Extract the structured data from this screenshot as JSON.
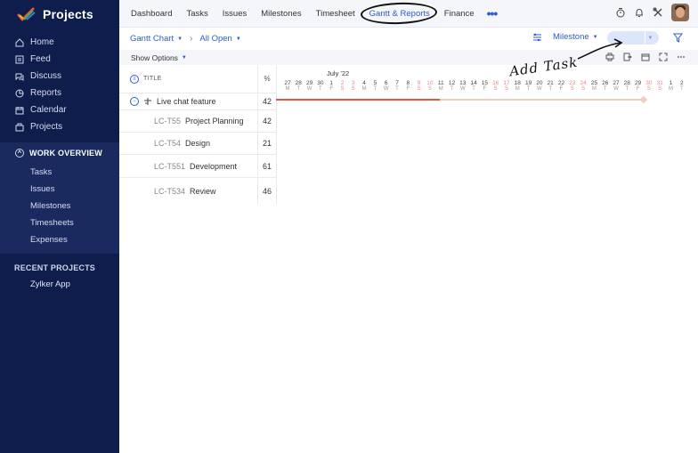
{
  "sidebar": {
    "brand": "Projects",
    "nav": [
      {
        "label": "Home",
        "icon": "home-icon"
      },
      {
        "label": "Feed",
        "icon": "feed-icon"
      },
      {
        "label": "Discuss",
        "icon": "discuss-icon"
      },
      {
        "label": "Reports",
        "icon": "reports-icon"
      },
      {
        "label": "Calendar",
        "icon": "calendar-icon"
      },
      {
        "label": "Projects",
        "icon": "projects-icon"
      }
    ],
    "work_overview": {
      "heading": "WORK OVERVIEW",
      "items": [
        "Tasks",
        "Issues",
        "Milestones",
        "Timesheets",
        "Expenses"
      ]
    },
    "recent": {
      "heading": "RECENT PROJECTS",
      "items": [
        "Zylker App"
      ]
    },
    "colors": {
      "background": "#0f1d4d",
      "section": "#1b2a5e"
    }
  },
  "topnav": {
    "tabs": [
      "Dashboard",
      "Tasks",
      "Issues",
      "Milestones",
      "Timesheet",
      "Gantt & Reports",
      "Finance"
    ],
    "active": "Gantt & Reports",
    "more": "•••"
  },
  "toolbar": {
    "view": "Gantt Chart",
    "filter": "All Open",
    "group_by": "Milestone"
  },
  "options": {
    "show_options": "Show Options"
  },
  "table": {
    "title_header": "TITLE",
    "pct_header": "%",
    "parent": {
      "title": "Live chat feature",
      "pct": "42"
    },
    "tasks": [
      {
        "id": "LC-T55",
        "name": "Project Planning",
        "pct": "42"
      },
      {
        "id": "LC-T54",
        "name": "Design",
        "pct": "21"
      },
      {
        "id": "LC-T551",
        "name": "Development",
        "pct": "61"
      },
      {
        "id": "LC-T534",
        "name": "Review",
        "pct": "46"
      }
    ]
  },
  "timeline": {
    "month": "July '22",
    "days": [
      {
        "n": "27",
        "d": "M"
      },
      {
        "n": "28",
        "d": "T"
      },
      {
        "n": "29",
        "d": "W"
      },
      {
        "n": "30",
        "d": "T"
      },
      {
        "n": "1",
        "d": "F"
      },
      {
        "n": "2",
        "d": "S"
      },
      {
        "n": "3",
        "d": "S"
      },
      {
        "n": "4",
        "d": "M"
      },
      {
        "n": "5",
        "d": "T"
      },
      {
        "n": "6",
        "d": "W"
      },
      {
        "n": "7",
        "d": "T"
      },
      {
        "n": "8",
        "d": "F"
      },
      {
        "n": "9",
        "d": "S"
      },
      {
        "n": "10",
        "d": "S"
      },
      {
        "n": "11",
        "d": "M"
      },
      {
        "n": "12",
        "d": "T"
      },
      {
        "n": "13",
        "d": "W"
      },
      {
        "n": "14",
        "d": "T"
      },
      {
        "n": "15",
        "d": "F"
      },
      {
        "n": "16",
        "d": "S"
      },
      {
        "n": "17",
        "d": "S"
      },
      {
        "n": "18",
        "d": "M"
      },
      {
        "n": "19",
        "d": "T"
      },
      {
        "n": "20",
        "d": "W"
      },
      {
        "n": "21",
        "d": "T"
      },
      {
        "n": "22",
        "d": "F"
      },
      {
        "n": "23",
        "d": "S"
      },
      {
        "n": "24",
        "d": "S"
      },
      {
        "n": "25",
        "d": "M"
      },
      {
        "n": "26",
        "d": "T"
      },
      {
        "n": "27",
        "d": "W"
      },
      {
        "n": "28",
        "d": "T"
      },
      {
        "n": "29",
        "d": "F"
      },
      {
        "n": "30",
        "d": "S"
      },
      {
        "n": "31",
        "d": "S"
      },
      {
        "n": "1",
        "d": "M"
      },
      {
        "n": "2",
        "d": "T"
      }
    ],
    "progress_color": "#e8553f",
    "remaining_color": "#f4c9c0"
  },
  "annotation": {
    "text": "Add Task"
  },
  "accent": "#2a5bd7"
}
